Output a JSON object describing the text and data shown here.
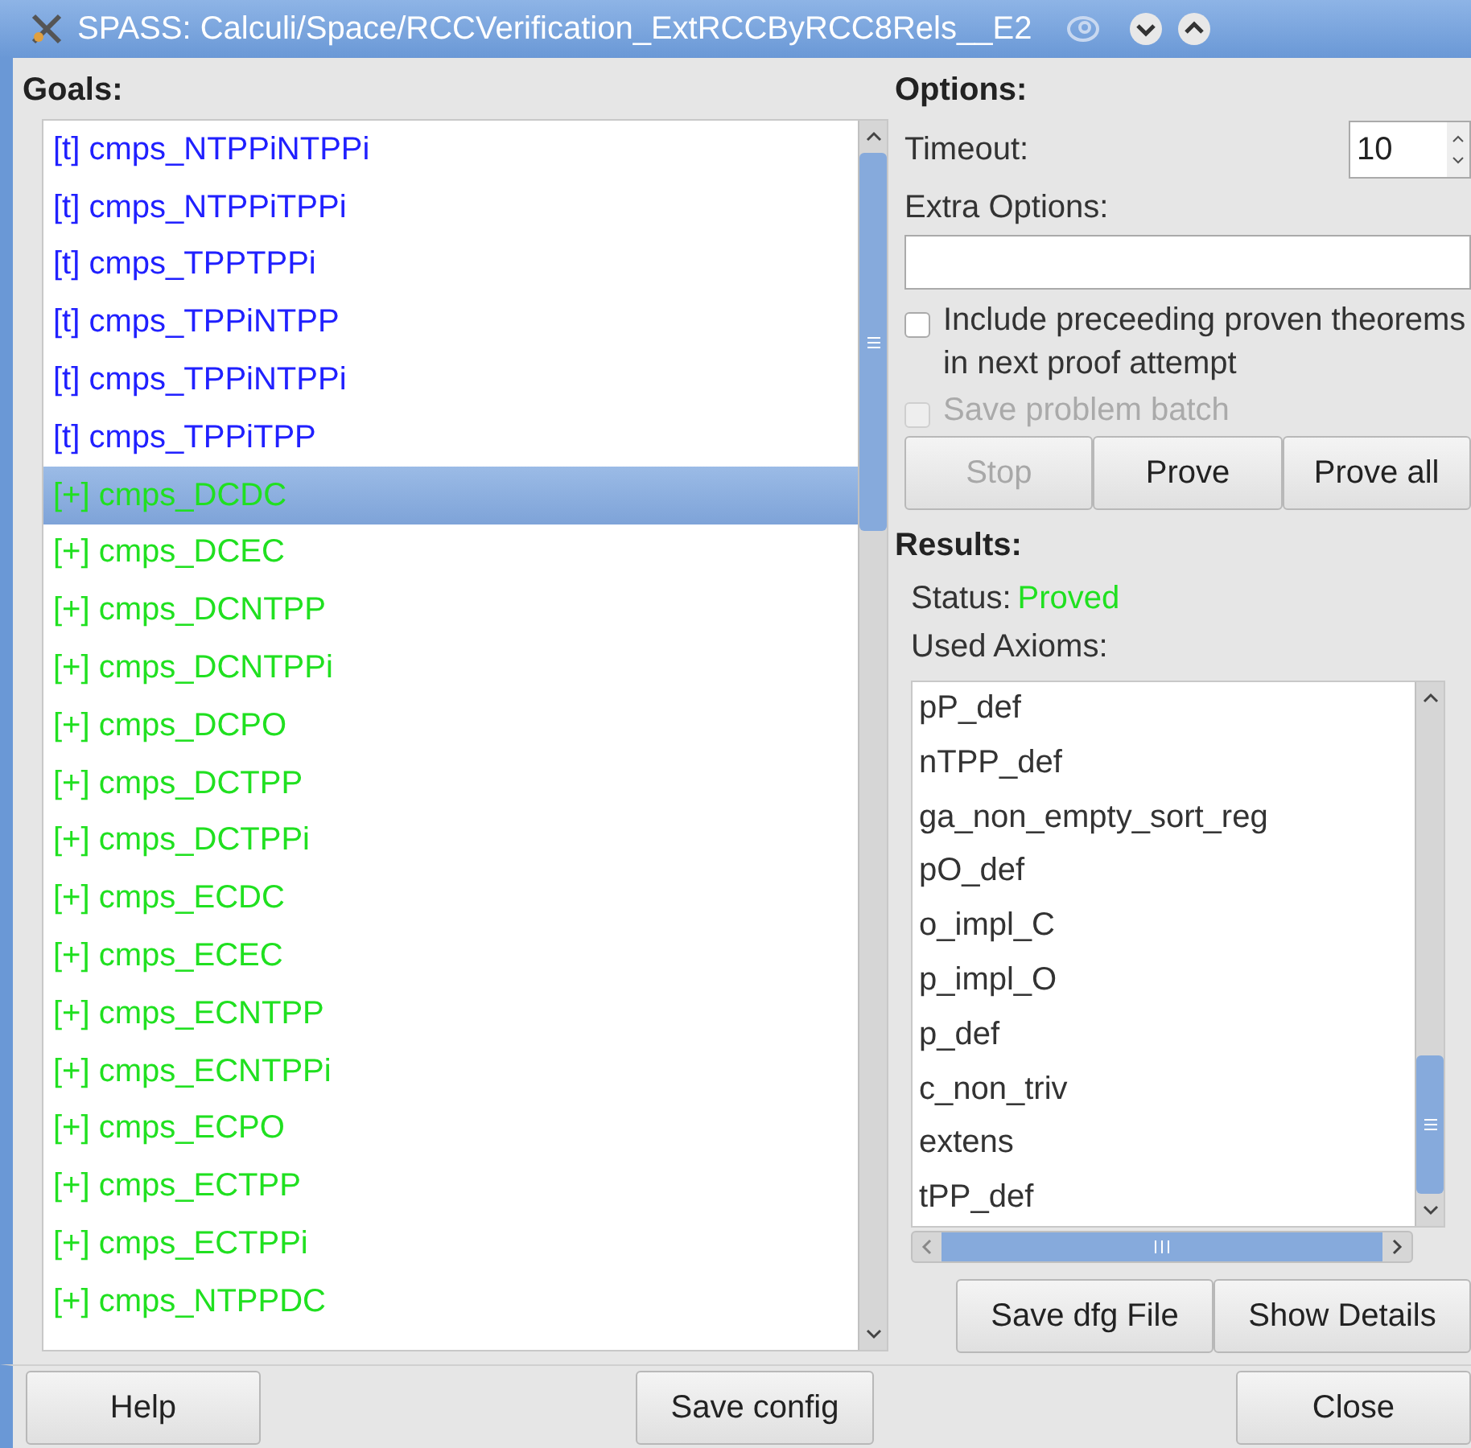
{
  "window": {
    "title": "SPASS: Calculi/Space/RCCVerification_ExtRCCByRCC8Rels__E2"
  },
  "goals": {
    "label": "Goals:",
    "items": [
      {
        "text": "[t] cmps_NTPPiNTPPi",
        "color": "#2020ff",
        "selected": false
      },
      {
        "text": "[t] cmps_NTPPiTPPi",
        "color": "#2020ff",
        "selected": false
      },
      {
        "text": "[t] cmps_TPPTPPi",
        "color": "#2020ff",
        "selected": false
      },
      {
        "text": "[t] cmps_TPPiNTPP",
        "color": "#2020ff",
        "selected": false
      },
      {
        "text": "[t] cmps_TPPiNTPPi",
        "color": "#2020ff",
        "selected": false
      },
      {
        "text": "[t] cmps_TPPiTPP",
        "color": "#2020ff",
        "selected": false
      },
      {
        "text": "[+] cmps_DCDC",
        "color": "#20e020",
        "selected": true
      },
      {
        "text": "[+] cmps_DCEC",
        "color": "#20e020",
        "selected": false
      },
      {
        "text": "[+] cmps_DCNTPP",
        "color": "#20e020",
        "selected": false
      },
      {
        "text": "[+] cmps_DCNTPPi",
        "color": "#20e020",
        "selected": false
      },
      {
        "text": "[+] cmps_DCPO",
        "color": "#20e020",
        "selected": false
      },
      {
        "text": "[+] cmps_DCTPP",
        "color": "#20e020",
        "selected": false
      },
      {
        "text": "[+] cmps_DCTPPi",
        "color": "#20e020",
        "selected": false
      },
      {
        "text": "[+] cmps_ECDC",
        "color": "#20e020",
        "selected": false
      },
      {
        "text": "[+] cmps_ECEC",
        "color": "#20e020",
        "selected": false
      },
      {
        "text": "[+] cmps_ECNTPP",
        "color": "#20e020",
        "selected": false
      },
      {
        "text": "[+] cmps_ECNTPPi",
        "color": "#20e020",
        "selected": false
      },
      {
        "text": "[+] cmps_ECPO",
        "color": "#20e020",
        "selected": false
      },
      {
        "text": "[+] cmps_ECTPP",
        "color": "#20e020",
        "selected": false
      },
      {
        "text": "[+] cmps_ECTPPi",
        "color": "#20e020",
        "selected": false
      },
      {
        "text": "[+] cmps_NTPPDC",
        "color": "#20e020",
        "selected": false
      }
    ]
  },
  "options": {
    "label": "Options:",
    "timeout_label": "Timeout:",
    "timeout_value": "10",
    "extra_label": "Extra Options:",
    "include_checkbox": {
      "label": "Include preceeding proven theorems in next proof attempt",
      "checked": false,
      "disabled": false
    },
    "save_batch_checkbox": {
      "label": "Save problem batch",
      "checked": false,
      "disabled": true
    },
    "buttons": [
      {
        "label": "Stop",
        "disabled": true
      },
      {
        "label": "Prove",
        "disabled": false
      },
      {
        "label": "Prove all",
        "disabled": false
      }
    ]
  },
  "results": {
    "label": "Results:",
    "status_label": "Status:",
    "status_value": "Proved",
    "axioms_label": "Used Axioms:",
    "axioms": [
      "pP_def",
      "nTPP_def",
      "ga_non_empty_sort_reg",
      "pO_def",
      "o_impl_C",
      "p_impl_O",
      "p_def",
      "c_non_triv",
      "extens",
      "tPP_def"
    ],
    "buttons": [
      "Save dfg File",
      "Show Details"
    ]
  },
  "footer_buttons": [
    "Help",
    "Save config",
    "Close"
  ]
}
